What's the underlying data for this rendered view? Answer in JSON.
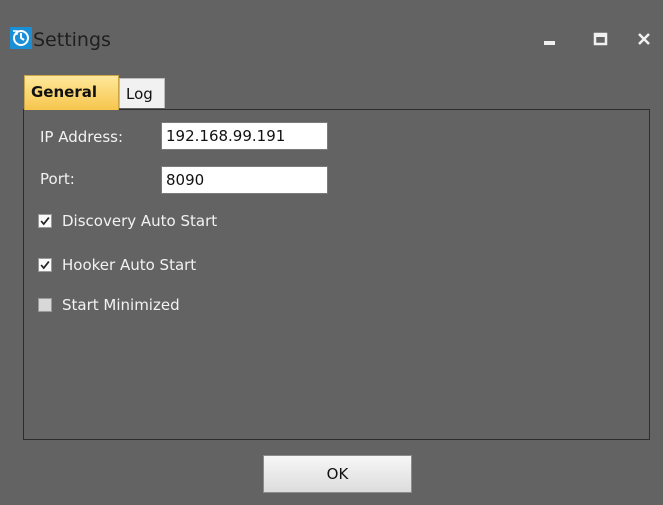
{
  "window": {
    "title": "Settings",
    "app_icon": "clock-refresh-icon",
    "controls": [
      "minimize-icon",
      "maximize-icon",
      "close-icon"
    ]
  },
  "tabs": [
    {
      "label": "General",
      "active": true
    },
    {
      "label": "Log",
      "active": false
    }
  ],
  "general": {
    "ip_label": "IP Address:",
    "ip_value": "192.168.99.191",
    "port_label": "Port:",
    "port_value": "8090",
    "options": [
      {
        "label": "Discovery Auto Start",
        "checked": true
      },
      {
        "label": "Hooker Auto Start",
        "checked": true
      },
      {
        "label": "Start Minimized",
        "checked": false
      }
    ]
  },
  "footer": {
    "ok_label": "OK"
  },
  "colors": {
    "background": "#636363",
    "tab_active": "#f6c64c",
    "app_icon": "#1b8fd6"
  }
}
